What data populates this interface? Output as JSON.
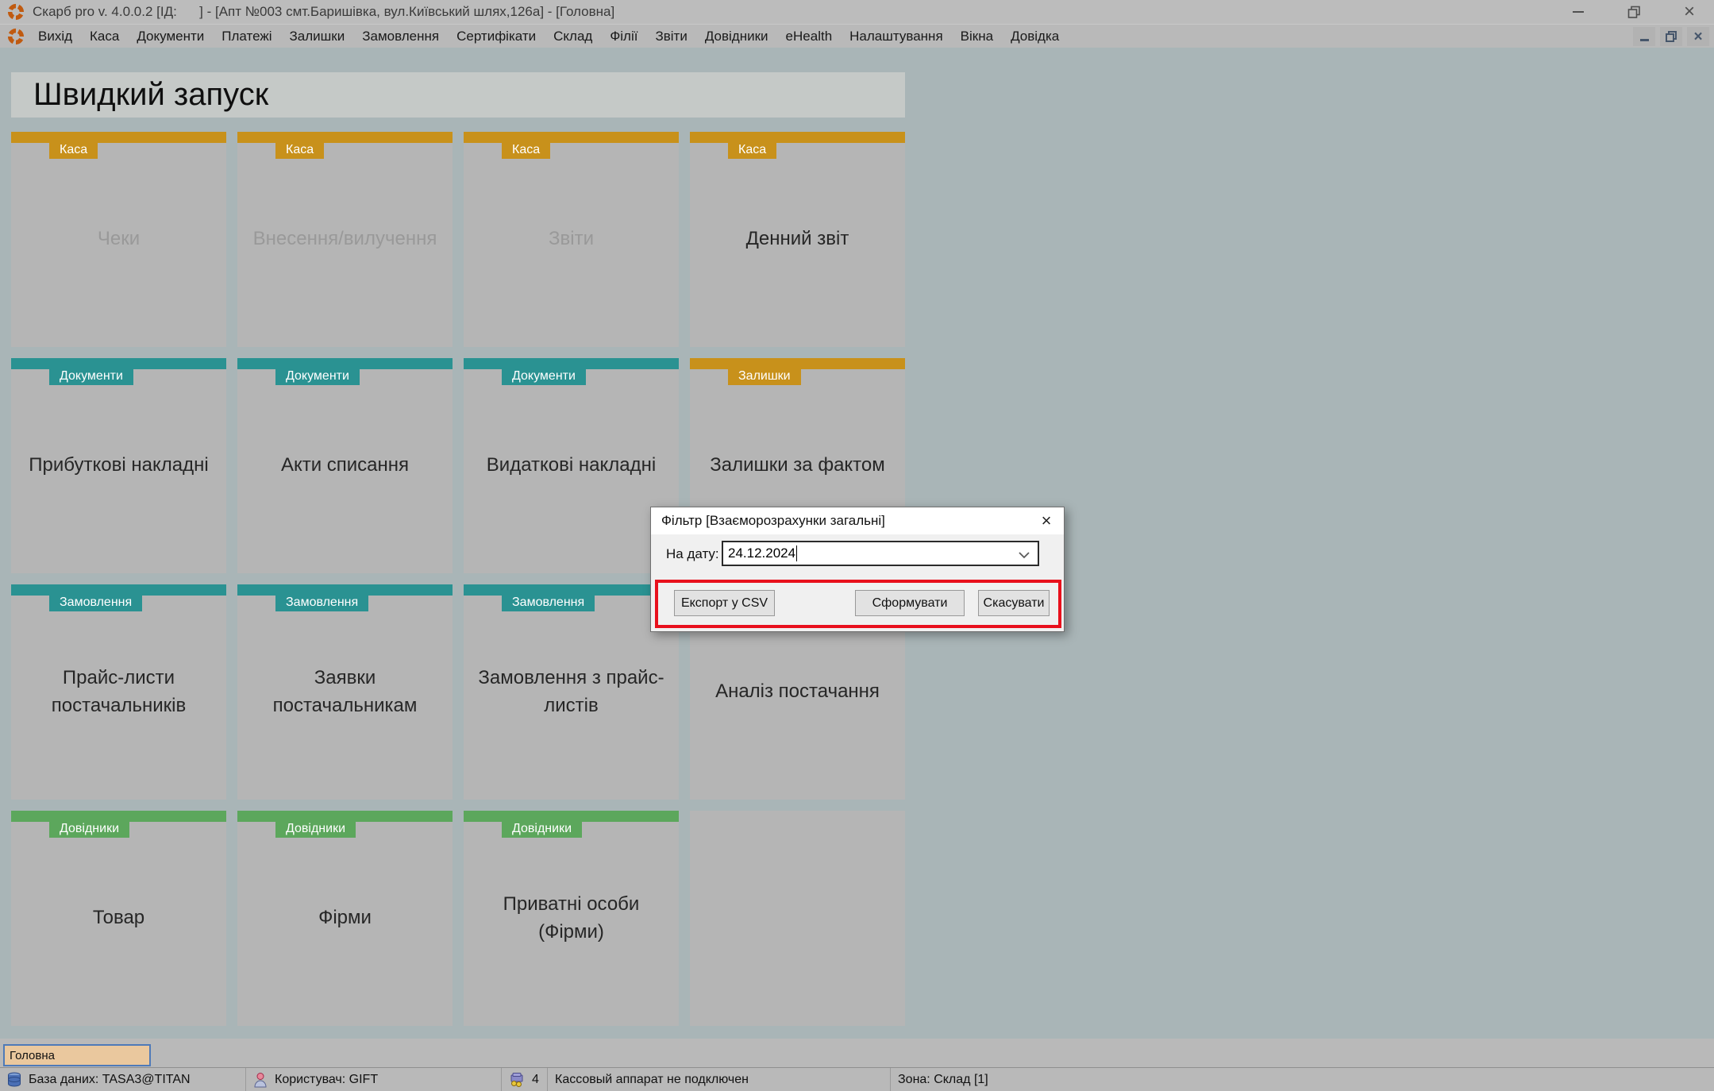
{
  "window": {
    "title": "Скарб pro v. 4.0.0.2 [ІД:      ] - [Апт №003 смт.Баришівка, вул.Київський шлях,126а] - [Головна]"
  },
  "menu": {
    "items": [
      "Вихід",
      "Каса",
      "Документи",
      "Платежі",
      "Залишки",
      "Замовлення",
      "Сертифікати",
      "Склад",
      "Філії",
      "Звіти",
      "Довідники",
      "eHealth",
      "Налаштування",
      "Вікна",
      "Довідка"
    ]
  },
  "quick_launch": {
    "title": "Швидкий запуск",
    "tiles": [
      {
        "category": "kasa",
        "label": "Чеки",
        "enabled": false
      },
      {
        "category": "kasa",
        "label": "Внесення/вилучення",
        "enabled": false
      },
      {
        "category": "kasa",
        "label": "Звіти",
        "enabled": false
      },
      {
        "category": "kasa",
        "label": "Денний звіт",
        "enabled": true
      },
      {
        "category": "documenty",
        "label": "Прибуткові накладні",
        "enabled": true
      },
      {
        "category": "documenty",
        "label": "Акти списання",
        "enabled": true
      },
      {
        "category": "documenty",
        "label": "Видаткові накладні",
        "enabled": true
      },
      {
        "category": "zalyshky",
        "label": "Залишки за фактом",
        "enabled": true
      },
      {
        "category": "zamovlennia",
        "label": "Прайс-листи постачальників",
        "enabled": true
      },
      {
        "category": "zamovlennia",
        "label": "Заявки постачальникам",
        "enabled": true
      },
      {
        "category": "zamovlennia",
        "label": "Замовлення з прайс-листів",
        "enabled": true
      },
      {
        "category": "zamovlennia",
        "label": "Аналіз постачання",
        "enabled": true
      },
      {
        "category": "dovidnyky",
        "label": "Товар",
        "enabled": true
      },
      {
        "category": "dovidnyky",
        "label": "Фірми",
        "enabled": true
      },
      {
        "category": "dovidnyky",
        "label": "Приватні особи (Фірми)",
        "enabled": true
      },
      {
        "category": null,
        "label": "",
        "empty": true
      }
    ]
  },
  "categories": {
    "kasa": {
      "label": "Каса",
      "color": "#c8911b"
    },
    "documenty": {
      "label": "Документи",
      "color": "#2a9292"
    },
    "zalyshky": {
      "label": "Залишки",
      "color": "#c8911b"
    },
    "zamovlennia": {
      "label": "Замовлення",
      "color": "#2a9292"
    },
    "dovidnyky": {
      "label": "Довідники",
      "color": "#5ca75c"
    }
  },
  "dialog": {
    "title": "Фільтр [Взаєморозрахунки загальні]",
    "close_glyph": "×",
    "date_label": "На дату:",
    "date_value": "24.12.2024",
    "buttons": {
      "export": "Експорт у CSV",
      "generate": "Сформувати",
      "cancel": "Скасувати"
    },
    "highlight_color": "#e8101c"
  },
  "tabs": {
    "active": "Головна",
    "active_color": "#eac89e"
  },
  "status_bar": {
    "database": "База даних: TASA3@TITAN",
    "user": "Користувач: GIFT",
    "cash_count": "4",
    "cash_status": "Кассовый аппарат не подключен",
    "zone": "Зона: Склад [1]"
  },
  "icons": {
    "app": "skarb-segmented-ring",
    "titlebar": [
      "minimize-icon",
      "restore-icon",
      "close-icon"
    ],
    "mdi": [
      "minimize-icon",
      "restore-icon",
      "close-icon"
    ],
    "combo": "chevron-down-icon",
    "status": [
      "database-icon",
      "user-icon",
      "cash-register-icon"
    ]
  }
}
